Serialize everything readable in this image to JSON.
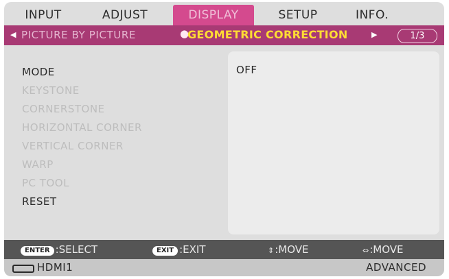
{
  "tabs": [
    {
      "label": "INPUT"
    },
    {
      "label": "ADJUST"
    },
    {
      "label": "DISPLAY"
    },
    {
      "label": "SETUP"
    },
    {
      "label": "INFO."
    }
  ],
  "active_tab": "DISPLAY",
  "submenu": {
    "previous": "PICTURE BY PICTURE",
    "current": "GEOMETRIC CORRECTION",
    "page": "1/3"
  },
  "items": [
    {
      "label": "MODE",
      "state": "enabled"
    },
    {
      "label": "KEYSTONE",
      "state": "disabled"
    },
    {
      "label": "CORNERSTONE",
      "state": "disabled"
    },
    {
      "label": "HORIZONTAL CORNER",
      "state": "disabled"
    },
    {
      "label": "VERTICAL CORNER",
      "state": "disabled"
    },
    {
      "label": "WARP",
      "state": "disabled"
    },
    {
      "label": "PC TOOL",
      "state": "disabled"
    },
    {
      "label": "RESET",
      "state": "enabled"
    }
  ],
  "value": "OFF",
  "help": {
    "enter_key": "ENTER",
    "select": ":SELECT",
    "exit_key": "EXIT",
    "exit": ":EXIT",
    "move_ud": ":MOVE",
    "move_lr": ":MOVE"
  },
  "status": {
    "source": "HDMI1",
    "mode": "ADVANCED"
  },
  "colors": {
    "active_tab": "#d44a8e",
    "submenu_bar": "#a83a74",
    "current_submenu": "#ffdd33",
    "help_bar": "#555555"
  }
}
